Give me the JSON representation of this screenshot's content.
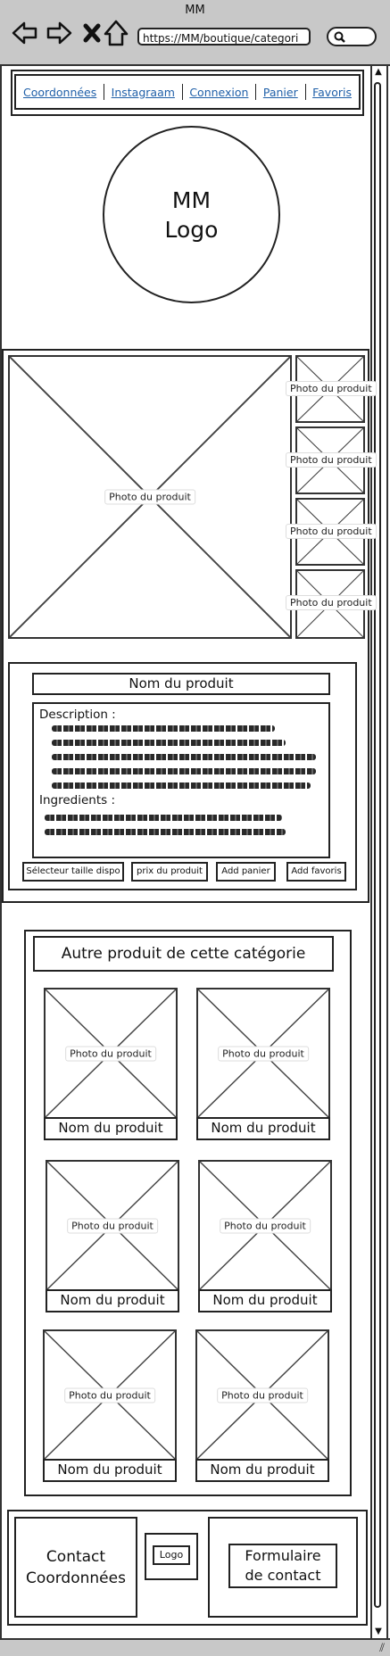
{
  "window": {
    "title": "MM",
    "url": "https://MM/boutique/categori"
  },
  "nav": {
    "links": [
      "Coordonnées",
      "Instagraam",
      "Connexion",
      "Panier",
      "Favoris"
    ]
  },
  "logo": {
    "line1": "MM",
    "line2": "Logo"
  },
  "product": {
    "main_photo": "Photo du produit",
    "thumbs": [
      "Photo du produit",
      "Photo du produit",
      "Photo du produit",
      "Photo du produit"
    ],
    "name": "Nom du produit",
    "description_label": "Description :",
    "ingredients_label": "Ingredients :",
    "buttons": {
      "size": "Sélecteur taille dispo",
      "price": "prix du produit",
      "cart": "Add panier",
      "fav": "Add favoris"
    }
  },
  "others": {
    "title": "Autre produit de cette catégorie",
    "cards": [
      {
        "photo": "Photo du produit",
        "name": "Nom du produit"
      },
      {
        "photo": "Photo du produit",
        "name": "Nom du produit"
      },
      {
        "photo": "Photo du produit",
        "name": "Nom du produit"
      },
      {
        "photo": "Photo du produit",
        "name": "Nom du produit"
      },
      {
        "photo": "Photo du produit",
        "name": "Nom du produit"
      },
      {
        "photo": "Photo du produit",
        "name": "Nom du produit"
      }
    ]
  },
  "footer": {
    "contact_line1": "Contact",
    "contact_line2": "Coordonnées",
    "logo": "Logo",
    "form_line1": "Formulaire",
    "form_line2": "de contact"
  }
}
